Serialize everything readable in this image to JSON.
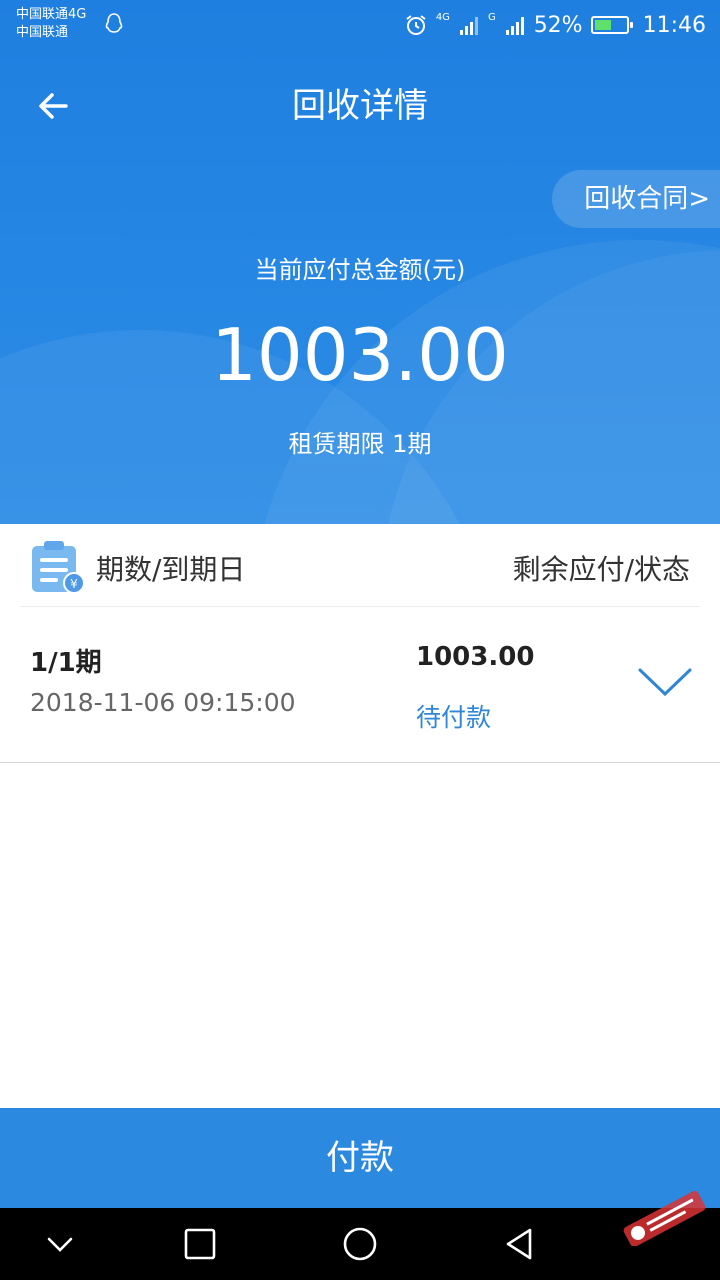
{
  "status_bar": {
    "carrier_line1": "中国联通4G",
    "carrier_line2": "中国联通",
    "network_1": "4G",
    "network_2": "G",
    "battery": "52%",
    "battery_level": 0.52,
    "time": "11:46",
    "icons": [
      "qq-icon",
      "alarm-icon",
      "signal-icon",
      "battery-icon"
    ]
  },
  "nav": {
    "back_icon": "arrow-left-icon",
    "title": "回收详情"
  },
  "summary": {
    "contract_link": "回收合同>",
    "amount_label": "当前应付总金额(元)",
    "amount": "1003.00",
    "term": "租赁期限 1期"
  },
  "list_header": {
    "icon": "bill-yuan-icon",
    "left": "期数/到期日",
    "right": "剩余应付/状态"
  },
  "rows": [
    {
      "period": "1/1期",
      "due_date": "2018-11-06 09:15:00",
      "amount": "1003.00",
      "status": "待付款",
      "expand_icon": "chevron-down-icon"
    }
  ],
  "pay_button": "付款",
  "system_nav": [
    "collapse-icon",
    "recents-icon",
    "home-icon",
    "back-icon"
  ],
  "colors": {
    "primary": "#2b8ae0",
    "status_text": "#2f86d6",
    "header_top": "#1f7fe0"
  }
}
